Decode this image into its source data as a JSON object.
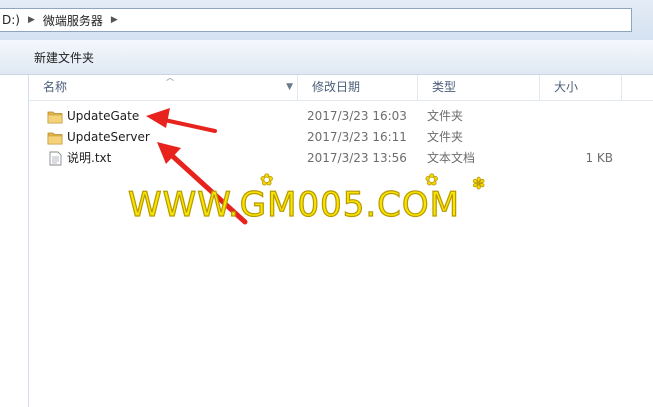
{
  "address": {
    "drive": "D:)",
    "folder": "微端服务器"
  },
  "toolbar": {
    "new_folder": "新建文件夹"
  },
  "columns": {
    "name": "名称",
    "date": "修改日期",
    "type": "类型",
    "size": "大小"
  },
  "rows": [
    {
      "name": "UpdateGate",
      "date": "2017/3/23 16:03",
      "type": "文件夹",
      "size": "",
      "icon": "folder-icon"
    },
    {
      "name": "UpdateServer",
      "date": "2017/3/23 16:11",
      "type": "文件夹",
      "size": "",
      "icon": "folder-icon"
    },
    {
      "name": "说明.txt",
      "date": "2017/3/23 13:56",
      "type": "文本文档",
      "size": "1 KB",
      "icon": "text-file-icon"
    }
  ],
  "watermark": {
    "text": "WWW.GM005.COM"
  },
  "colors": {
    "annotation_arrow": "#e8231e",
    "watermark": "#f7e400",
    "folder": "#e9c05a"
  }
}
